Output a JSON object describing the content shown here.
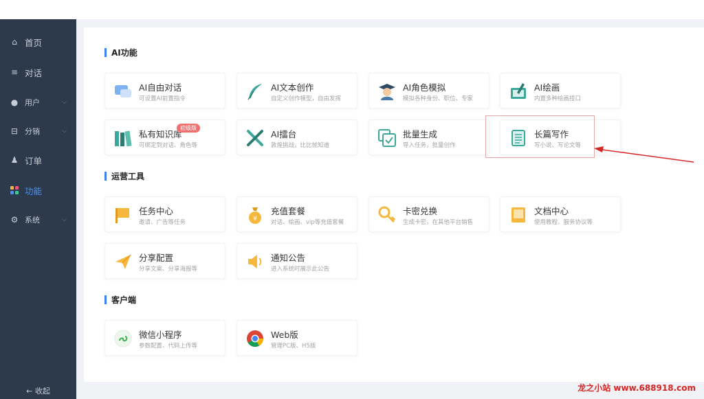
{
  "sidebar": {
    "items": [
      {
        "label": "首页",
        "icon": "home-icon",
        "glyph": "⌂",
        "active": false,
        "chevron": false
      },
      {
        "label": "对话",
        "icon": "list-icon",
        "glyph": "≡",
        "active": false,
        "chevron": false
      },
      {
        "label": "用户",
        "icon": "user-icon",
        "glyph": "●",
        "active": false,
        "chevron": true
      },
      {
        "label": "分销",
        "icon": "distribution-icon",
        "glyph": "⊟",
        "active": false,
        "chevron": true
      },
      {
        "label": "订单",
        "icon": "order-icon",
        "glyph": "♟",
        "active": false,
        "chevron": false
      },
      {
        "label": "功能",
        "icon": "apps-icon",
        "glyph": "■",
        "active": true,
        "chevron": false
      },
      {
        "label": "系统",
        "icon": "gear-icon",
        "glyph": "⚙",
        "active": false,
        "chevron": true
      }
    ],
    "collapse_label": "← 收起"
  },
  "sections": {
    "ai": {
      "title": "AI功能",
      "cards": [
        {
          "title": "AI自由对话",
          "desc": "可设置AI前置指令",
          "icon": "chat-bubble-icon"
        },
        {
          "title": "AI文本创作",
          "desc": "自定义创作模型，自由发挥",
          "icon": "feather-icon"
        },
        {
          "title": "AI角色模拟",
          "desc": "模拟各种身份、职位、专家",
          "icon": "graduate-icon"
        },
        {
          "title": "AI绘画",
          "desc": "内置多种绘画接口",
          "icon": "paint-icon"
        },
        {
          "title": "私有知识库",
          "desc": "可绑定到对话、角色等",
          "icon": "books-icon",
          "badge": "初级版"
        },
        {
          "title": "AI擂台",
          "desc": "敦煌挑战，比比就知道",
          "icon": "swords-icon"
        },
        {
          "title": "批量生成",
          "desc": "导入任务，批量创作",
          "icon": "batch-check-icon"
        },
        {
          "title": "长篇写作",
          "desc": "写小说、写论文等",
          "icon": "scroll-icon"
        }
      ]
    },
    "ops": {
      "title": "运营工具",
      "cards": [
        {
          "title": "任务中心",
          "desc": "邀请、广告等任务",
          "icon": "flag-icon"
        },
        {
          "title": "充值套餐",
          "desc": "对话、绘画、vip等充值套餐",
          "icon": "money-bag-icon"
        },
        {
          "title": "卡密兑换",
          "desc": "生成卡密，在其他平台销售",
          "icon": "key-icon"
        },
        {
          "title": "文档中心",
          "desc": "使用教程、服务协议等",
          "icon": "document-icon"
        },
        {
          "title": "分享配置",
          "desc": "分享文案、分享海报等",
          "icon": "paper-plane-icon"
        },
        {
          "title": "通知公告",
          "desc": "进入系统时展示此公告",
          "icon": "speaker-icon"
        }
      ]
    },
    "client": {
      "title": "客户端",
      "cards": [
        {
          "title": "微信小程序",
          "desc": "参数配置、代码上传等",
          "icon": "mini-program-icon"
        },
        {
          "title": "Web版",
          "desc": "管理PC版、H5版",
          "icon": "browser-icon"
        }
      ]
    }
  },
  "watermark": "龙之小站 www.688918.com",
  "colors": {
    "sidebar_bg": "#2d3a4b",
    "accent": "#3d7ff5",
    "badge": "#f07070",
    "highlight": "#e7a6a6",
    "arrow": "#d52525"
  }
}
